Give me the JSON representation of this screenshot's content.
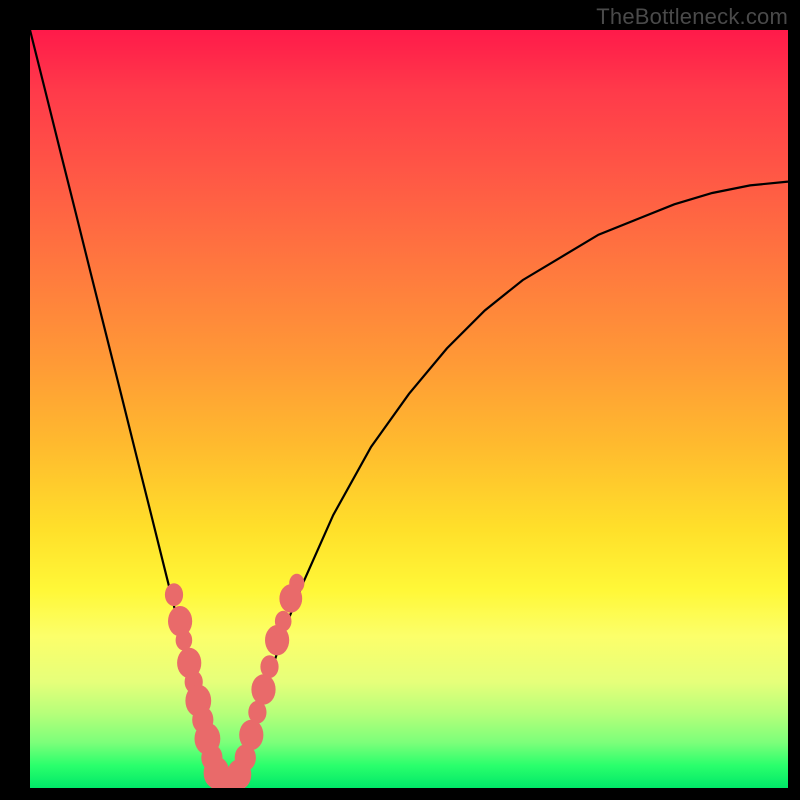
{
  "watermark": "TheBottleneck.com",
  "colors": {
    "frame": "#000000",
    "curve": "#000000",
    "marker_fill": "#e96a6a",
    "marker_stroke": "#c94f4f",
    "gradient_stops": [
      "#ff1a4a",
      "#ff7a3e",
      "#ffe02a",
      "#fcff6a",
      "#2bff6c"
    ]
  },
  "chart_data": {
    "type": "line",
    "title": "",
    "xlabel": "",
    "ylabel": "",
    "xlim": [
      0,
      100
    ],
    "ylim": [
      0,
      100
    ],
    "x": [
      0,
      2,
      4,
      6,
      8,
      10,
      12,
      14,
      16,
      18,
      20,
      22,
      23,
      24,
      25,
      26,
      27,
      28,
      30,
      32,
      34,
      36,
      40,
      45,
      50,
      55,
      60,
      65,
      70,
      75,
      80,
      85,
      90,
      95,
      100
    ],
    "y": [
      100,
      92,
      84,
      76,
      68,
      60,
      52,
      44,
      36,
      28,
      20,
      12,
      8,
      4,
      1,
      0,
      1,
      4,
      10,
      16,
      22,
      27,
      36,
      45,
      52,
      58,
      63,
      67,
      70,
      73,
      75,
      77,
      78.5,
      79.5,
      80
    ],
    "note": "values are approximate readings from the figure; y is bottleneck % (0=green bottom, 100=red top), curve has a V minimum near x≈26 then rises with diminishing slope",
    "markers_left_branch": [
      {
        "x": 19.0,
        "y": 25.5,
        "r": 1.2
      },
      {
        "x": 19.8,
        "y": 22.0,
        "r": 1.6
      },
      {
        "x": 20.3,
        "y": 19.5,
        "r": 1.1
      },
      {
        "x": 21.0,
        "y": 16.5,
        "r": 1.6
      },
      {
        "x": 21.6,
        "y": 14.0,
        "r": 1.2
      },
      {
        "x": 22.2,
        "y": 11.5,
        "r": 1.7
      },
      {
        "x": 22.8,
        "y": 9.0,
        "r": 1.4
      },
      {
        "x": 23.4,
        "y": 6.5,
        "r": 1.7
      },
      {
        "x": 24.0,
        "y": 4.0,
        "r": 1.4
      },
      {
        "x": 24.6,
        "y": 2.0,
        "r": 1.7
      }
    ],
    "markers_bottom": [
      {
        "x": 25.2,
        "y": 0.8,
        "r": 1.4
      },
      {
        "x": 26.0,
        "y": 0.4,
        "r": 1.6
      },
      {
        "x": 26.8,
        "y": 0.8,
        "r": 1.4
      },
      {
        "x": 27.6,
        "y": 1.8,
        "r": 1.6
      }
    ],
    "markers_right_branch": [
      {
        "x": 28.4,
        "y": 4.0,
        "r": 1.4
      },
      {
        "x": 29.2,
        "y": 7.0,
        "r": 1.6
      },
      {
        "x": 30.0,
        "y": 10.0,
        "r": 1.2
      },
      {
        "x": 30.8,
        "y": 13.0,
        "r": 1.6
      },
      {
        "x": 31.6,
        "y": 16.0,
        "r": 1.2
      },
      {
        "x": 32.6,
        "y": 19.5,
        "r": 1.6
      },
      {
        "x": 33.4,
        "y": 22.0,
        "r": 1.1
      },
      {
        "x": 34.4,
        "y": 25.0,
        "r": 1.5
      },
      {
        "x": 35.2,
        "y": 27.0,
        "r": 1.0
      }
    ]
  }
}
